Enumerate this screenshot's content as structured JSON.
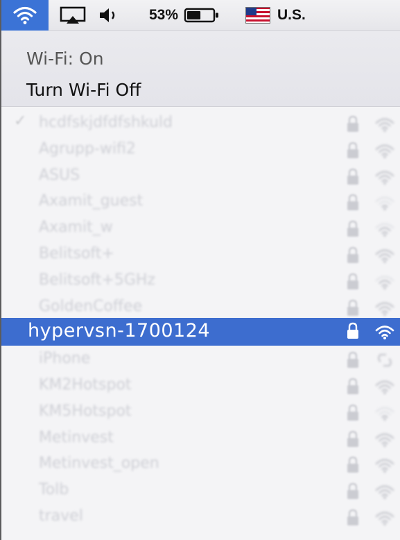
{
  "menubar": {
    "wifi_icon": "wifi-icon",
    "airplay_icon": "airplay-icon",
    "volume_icon": "volume-icon",
    "battery_percent": "53%",
    "battery_level": 0.53,
    "input_source": "U.S.",
    "flag_icon": "us-flag-icon"
  },
  "wifi": {
    "status": "Wi-Fi: On",
    "toggle_label": "Turn Wi-Fi Off"
  },
  "colors": {
    "highlight": "#3d6dcf",
    "menubar_active": "#3b73d6"
  },
  "networks": [
    {
      "name": "hcdfskjdfdfshkuld",
      "connected": true,
      "locked": true,
      "signal": 3
    },
    {
      "name": "Agrupp-wifi2",
      "locked": true,
      "signal": 3
    },
    {
      "name": "ASUS",
      "locked": true,
      "signal": 3
    },
    {
      "name": "Axamit_guest",
      "locked": true,
      "signal": 1
    },
    {
      "name": "Axamit_w",
      "locked": true,
      "signal": 2
    },
    {
      "name": "Belitsoft+",
      "locked": true,
      "signal": 3
    },
    {
      "name": "Belitsoft+5GHz",
      "locked": true,
      "signal": 2
    },
    {
      "name": "GoldenCoffee",
      "locked": true,
      "signal": 3
    },
    {
      "name": "hypervsn-1700124",
      "locked": true,
      "signal": 3,
      "selected": true
    },
    {
      "name": "iPhone",
      "locked": true,
      "signal": 3,
      "hotspot": true
    },
    {
      "name": "KM2Hotspot",
      "locked": true,
      "signal": 3
    },
    {
      "name": "KM5Hotspot",
      "locked": true,
      "signal": 1
    },
    {
      "name": "Metinvest",
      "locked": true,
      "signal": 3
    },
    {
      "name": "Metinvest_open",
      "locked": true,
      "signal": 3
    },
    {
      "name": "Tolb",
      "locked": true,
      "signal": 3
    },
    {
      "name": "travel",
      "locked": true,
      "signal": 3
    }
  ]
}
